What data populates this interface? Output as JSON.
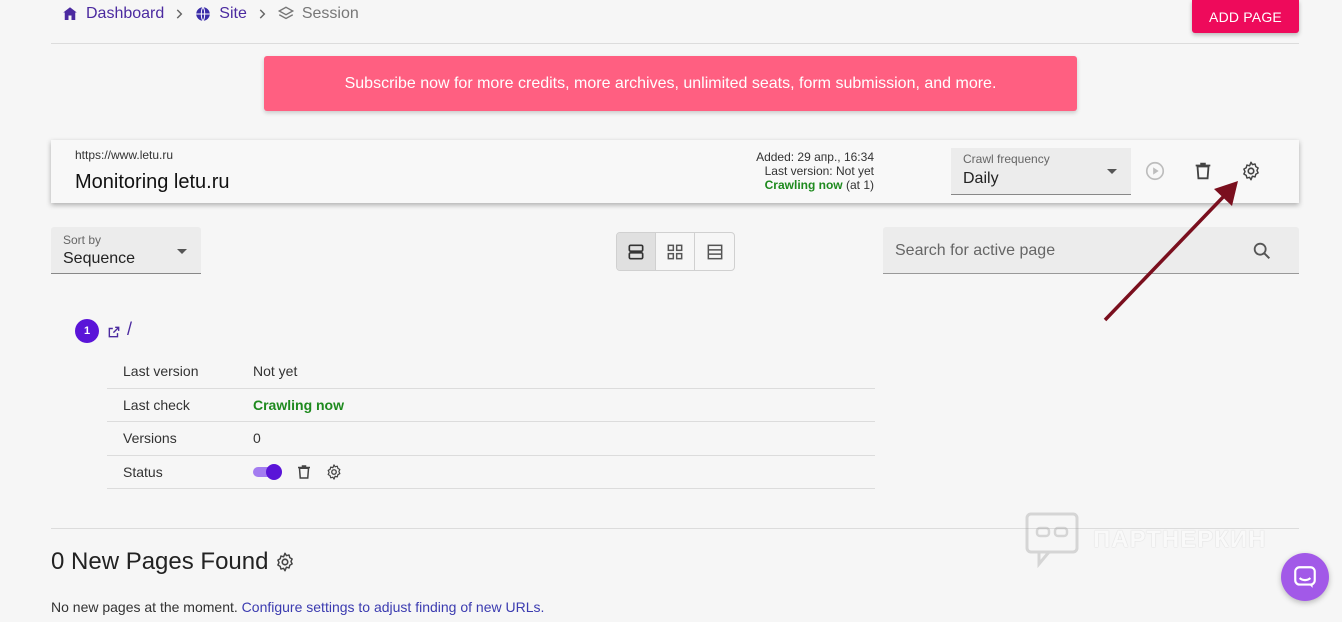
{
  "breadcrumb": {
    "items": [
      {
        "label": "Dashboard",
        "icon": "home-icon"
      },
      {
        "label": "Site",
        "icon": "globe-icon"
      },
      {
        "label": "Session",
        "icon": "layers-icon"
      }
    ]
  },
  "header": {
    "add_page_label": "ADD PAGE"
  },
  "banner": {
    "text": "Subscribe now for more credits, more archives, unlimited seats, form submission, and more."
  },
  "session": {
    "url": "https://www.letu.ru",
    "title": "Monitoring letu.ru",
    "added": "Added: 29 апр., 16:34",
    "last_version": "Last version: Not yet",
    "crawling_status": "Crawling now",
    "crawling_suffix": "(at 1)",
    "crawl_frequency_label": "Crawl frequency",
    "crawl_frequency_value": "Daily"
  },
  "toolbar": {
    "sort_label": "Sort by",
    "sort_value": "Sequence",
    "search_placeholder": "Search for active page"
  },
  "page_item": {
    "number": "1",
    "path": "/",
    "rows": [
      {
        "key": "Last version",
        "value": "Not yet"
      },
      {
        "key": "Last check",
        "value": "Crawling now"
      },
      {
        "key": "Versions",
        "value": "0"
      },
      {
        "key": "Status",
        "value": ""
      }
    ],
    "status_enabled": true
  },
  "new_pages": {
    "title": "0 New Pages Found",
    "note_prefix": "No new pages at the moment.",
    "note_link": "Configure settings to adjust finding of new URLs."
  },
  "watermark": {
    "text": "ПАРТНЕРКИН"
  },
  "colors": {
    "accent": "#ee0a5b",
    "banner": "#ff5f81",
    "primary": "#5a14d8",
    "success": "#1e8a1e",
    "annotation_arrow": "#7a0f1e"
  }
}
